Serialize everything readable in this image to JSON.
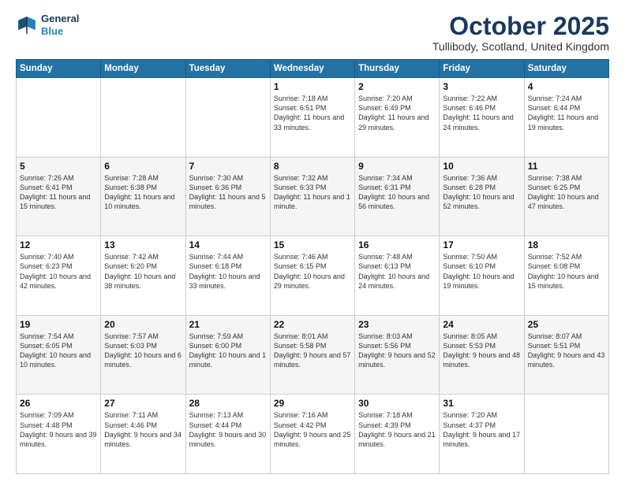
{
  "header": {
    "logo_line1": "General",
    "logo_line2": "Blue",
    "month": "October 2025",
    "location": "Tullibody, Scotland, United Kingdom"
  },
  "weekdays": [
    "Sunday",
    "Monday",
    "Tuesday",
    "Wednesday",
    "Thursday",
    "Friday",
    "Saturday"
  ],
  "weeks": [
    [
      {
        "day": "",
        "info": ""
      },
      {
        "day": "",
        "info": ""
      },
      {
        "day": "",
        "info": ""
      },
      {
        "day": "1",
        "info": "Sunrise: 7:18 AM\nSunset: 6:51 PM\nDaylight: 11 hours\nand 33 minutes."
      },
      {
        "day": "2",
        "info": "Sunrise: 7:20 AM\nSunset: 6:49 PM\nDaylight: 11 hours\nand 29 minutes."
      },
      {
        "day": "3",
        "info": "Sunrise: 7:22 AM\nSunset: 6:46 PM\nDaylight: 11 hours\nand 24 minutes."
      },
      {
        "day": "4",
        "info": "Sunrise: 7:24 AM\nSunset: 6:44 PM\nDaylight: 11 hours\nand 19 minutes."
      }
    ],
    [
      {
        "day": "5",
        "info": "Sunrise: 7:26 AM\nSunset: 6:41 PM\nDaylight: 11 hours\nand 15 minutes."
      },
      {
        "day": "6",
        "info": "Sunrise: 7:28 AM\nSunset: 6:38 PM\nDaylight: 11 hours\nand 10 minutes."
      },
      {
        "day": "7",
        "info": "Sunrise: 7:30 AM\nSunset: 6:36 PM\nDaylight: 11 hours\nand 5 minutes."
      },
      {
        "day": "8",
        "info": "Sunrise: 7:32 AM\nSunset: 6:33 PM\nDaylight: 11 hours\nand 1 minute."
      },
      {
        "day": "9",
        "info": "Sunrise: 7:34 AM\nSunset: 6:31 PM\nDaylight: 10 hours\nand 56 minutes."
      },
      {
        "day": "10",
        "info": "Sunrise: 7:36 AM\nSunset: 6:28 PM\nDaylight: 10 hours\nand 52 minutes."
      },
      {
        "day": "11",
        "info": "Sunrise: 7:38 AM\nSunset: 6:25 PM\nDaylight: 10 hours\nand 47 minutes."
      }
    ],
    [
      {
        "day": "12",
        "info": "Sunrise: 7:40 AM\nSunset: 6:23 PM\nDaylight: 10 hours\nand 42 minutes."
      },
      {
        "day": "13",
        "info": "Sunrise: 7:42 AM\nSunset: 6:20 PM\nDaylight: 10 hours\nand 38 minutes."
      },
      {
        "day": "14",
        "info": "Sunrise: 7:44 AM\nSunset: 6:18 PM\nDaylight: 10 hours\nand 33 minutes."
      },
      {
        "day": "15",
        "info": "Sunrise: 7:46 AM\nSunset: 6:15 PM\nDaylight: 10 hours\nand 29 minutes."
      },
      {
        "day": "16",
        "info": "Sunrise: 7:48 AM\nSunset: 6:13 PM\nDaylight: 10 hours\nand 24 minutes."
      },
      {
        "day": "17",
        "info": "Sunrise: 7:50 AM\nSunset: 6:10 PM\nDaylight: 10 hours\nand 19 minutes."
      },
      {
        "day": "18",
        "info": "Sunrise: 7:52 AM\nSunset: 6:08 PM\nDaylight: 10 hours\nand 15 minutes."
      }
    ],
    [
      {
        "day": "19",
        "info": "Sunrise: 7:54 AM\nSunset: 6:05 PM\nDaylight: 10 hours\nand 10 minutes."
      },
      {
        "day": "20",
        "info": "Sunrise: 7:57 AM\nSunset: 6:03 PM\nDaylight: 10 hours\nand 6 minutes."
      },
      {
        "day": "21",
        "info": "Sunrise: 7:59 AM\nSunset: 6:00 PM\nDaylight: 10 hours\nand 1 minute."
      },
      {
        "day": "22",
        "info": "Sunrise: 8:01 AM\nSunset: 5:58 PM\nDaylight: 9 hours\nand 57 minutes."
      },
      {
        "day": "23",
        "info": "Sunrise: 8:03 AM\nSunset: 5:56 PM\nDaylight: 9 hours\nand 52 minutes."
      },
      {
        "day": "24",
        "info": "Sunrise: 8:05 AM\nSunset: 5:53 PM\nDaylight: 9 hours\nand 48 minutes."
      },
      {
        "day": "25",
        "info": "Sunrise: 8:07 AM\nSunset: 5:51 PM\nDaylight: 9 hours\nand 43 minutes."
      }
    ],
    [
      {
        "day": "26",
        "info": "Sunrise: 7:09 AM\nSunset: 4:48 PM\nDaylight: 9 hours\nand 39 minutes."
      },
      {
        "day": "27",
        "info": "Sunrise: 7:11 AM\nSunset: 4:46 PM\nDaylight: 9 hours\nand 34 minutes."
      },
      {
        "day": "28",
        "info": "Sunrise: 7:13 AM\nSunset: 4:44 PM\nDaylight: 9 hours\nand 30 minutes."
      },
      {
        "day": "29",
        "info": "Sunrise: 7:16 AM\nSunset: 4:42 PM\nDaylight: 9 hours\nand 25 minutes."
      },
      {
        "day": "30",
        "info": "Sunrise: 7:18 AM\nSunset: 4:39 PM\nDaylight: 9 hours\nand 21 minutes."
      },
      {
        "day": "31",
        "info": "Sunrise: 7:20 AM\nSunset: 4:37 PM\nDaylight: 9 hours\nand 17 minutes."
      },
      {
        "day": "",
        "info": ""
      }
    ]
  ]
}
